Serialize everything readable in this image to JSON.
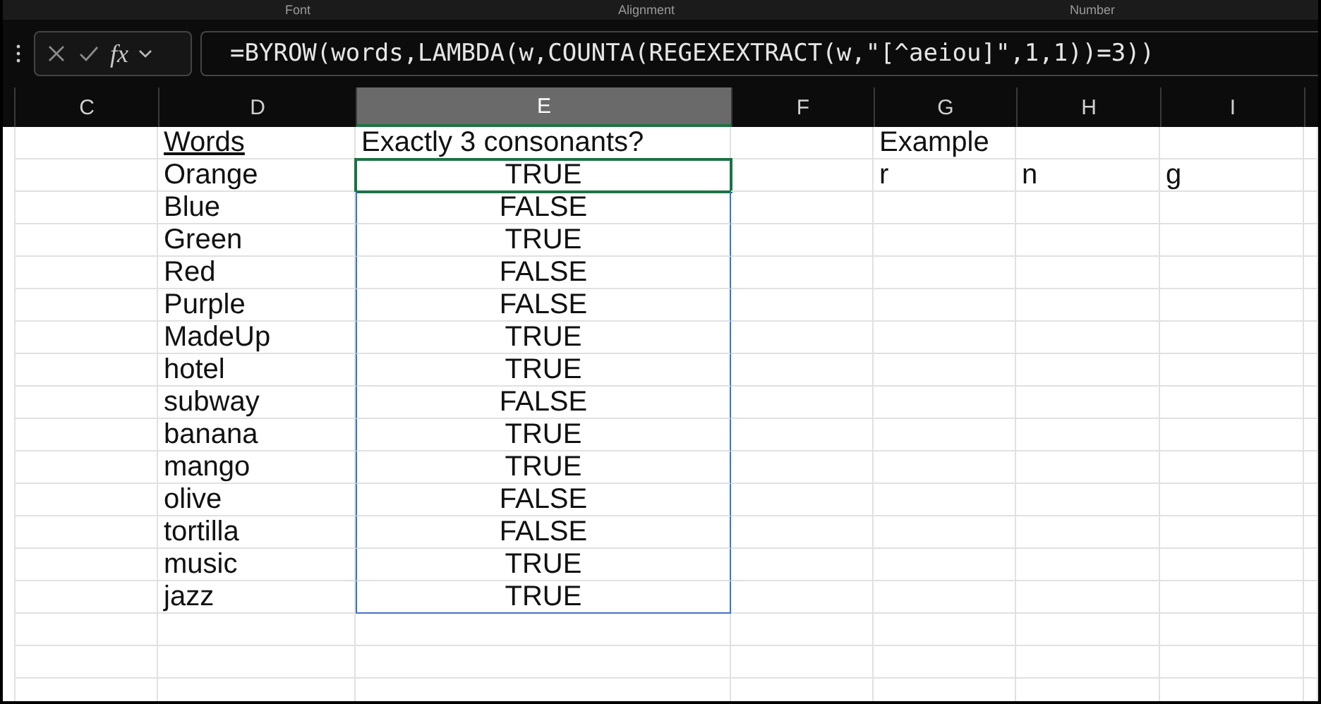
{
  "ribbon_groups": [
    "Font",
    "Alignment",
    "Number"
  ],
  "formula_bar": {
    "function_label": "fx",
    "formula": "=BYROW(words,LAMBDA(w,COUNTA(REGEXEXTRACT(w,\"[^aeiou]\",1,1))=3))"
  },
  "columns": [
    {
      "label": "C",
      "selected": false
    },
    {
      "label": "D",
      "selected": false
    },
    {
      "label": "E",
      "selected": true
    },
    {
      "label": "F",
      "selected": false
    },
    {
      "label": "G",
      "selected": false
    },
    {
      "label": "H",
      "selected": false
    },
    {
      "label": "I",
      "selected": false
    }
  ],
  "header": {
    "word_label": "Words",
    "result_label": "Exactly 3 consonants?",
    "example_label": "Example"
  },
  "rows": [
    {
      "word": "Orange",
      "result": "TRUE",
      "selected": true,
      "example": [
        "r",
        "n",
        "g"
      ]
    },
    {
      "word": "Blue",
      "result": "FALSE",
      "selected": false
    },
    {
      "word": "Green",
      "result": "TRUE",
      "selected": false
    },
    {
      "word": "Red",
      "result": "FALSE",
      "selected": false
    },
    {
      "word": "Purple",
      "result": "FALSE",
      "selected": false
    },
    {
      "word": "MadeUp",
      "result": "TRUE",
      "selected": false
    },
    {
      "word": "hotel",
      "result": "TRUE",
      "selected": false
    },
    {
      "word": "subway",
      "result": "FALSE",
      "selected": false
    },
    {
      "word": "banana",
      "result": "TRUE",
      "selected": false
    },
    {
      "word": "mango",
      "result": "TRUE",
      "selected": false
    },
    {
      "word": "olive",
      "result": "FALSE",
      "selected": false
    },
    {
      "word": "tortilla",
      "result": "FALSE",
      "selected": false
    },
    {
      "word": "music",
      "result": "TRUE",
      "selected": false
    },
    {
      "word": "jazz",
      "result": "TRUE",
      "selected": false
    }
  ]
}
